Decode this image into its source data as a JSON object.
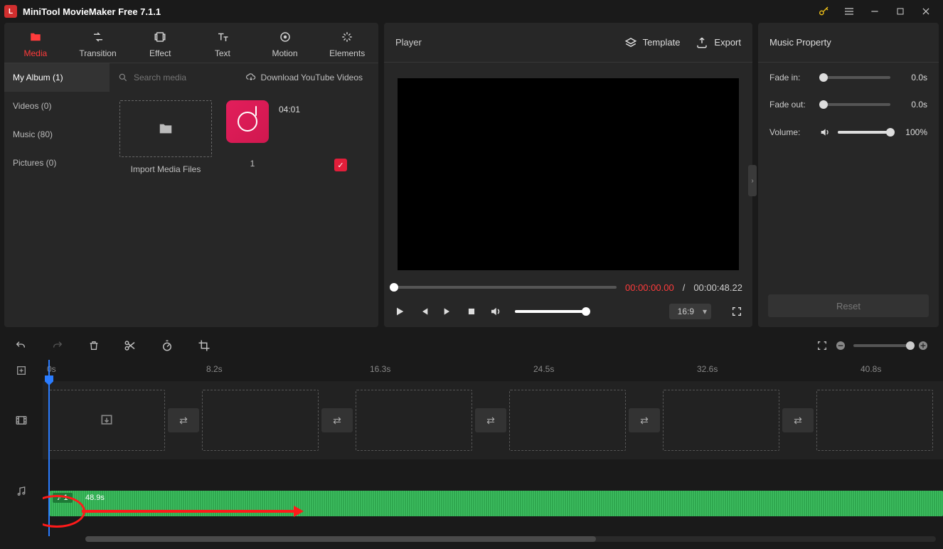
{
  "title": "MiniTool MovieMaker Free 7.1.1",
  "tabs": {
    "media": "Media",
    "transition": "Transition",
    "effect": "Effect",
    "text": "Text",
    "motion": "Motion",
    "elements": "Elements"
  },
  "sidebar": {
    "album": "My Album (1)",
    "videos": "Videos (0)",
    "music": "Music (80)",
    "pictures": "Pictures (0)"
  },
  "search": {
    "placeholder": "Search media",
    "download": "Download YouTube Videos"
  },
  "import": {
    "label": "Import Media Files"
  },
  "mediaItem": {
    "duration": "04:01",
    "index": "1"
  },
  "player": {
    "label": "Player",
    "template": "Template",
    "export": "Export",
    "current": "00:00:00.00",
    "sep": "/",
    "total": "00:00:48.22",
    "aspect": "16:9"
  },
  "props": {
    "title": "Music Property",
    "fadein_label": "Fade in:",
    "fadein_val": "0.0s",
    "fadeout_label": "Fade out:",
    "fadeout_val": "0.0s",
    "volume_label": "Volume:",
    "volume_val": "100%",
    "reset": "Reset"
  },
  "ruler": {
    "t0": "0s",
    "t1": "8.2s",
    "t2": "16.3s",
    "t3": "24.5s",
    "t4": "32.6s",
    "t5": "40.8s"
  },
  "audio": {
    "name": "1",
    "length": "48.9s"
  }
}
